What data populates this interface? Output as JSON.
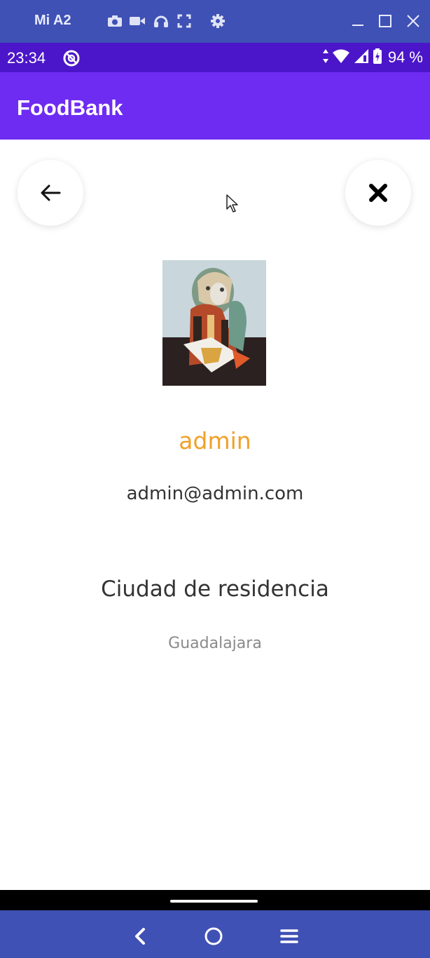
{
  "window": {
    "title": "Mi A2",
    "tools": [
      "camera-icon",
      "video-icon",
      "headset-icon",
      "fullscreen-icon",
      "settings-icon"
    ],
    "controls": [
      "minimize-icon",
      "maximize-icon",
      "close-window-icon"
    ]
  },
  "status_bar": {
    "time": "23:34",
    "battery": "94 %"
  },
  "app_bar": {
    "title": "FoodBank"
  },
  "profile": {
    "name": "admin",
    "email": "admin@admin.com",
    "city_label": "Ciudad de residencia",
    "city": "Guadalajara"
  },
  "colors": {
    "window_bar": "#3f51b5",
    "status_bar": "#4b16c9",
    "app_bar": "#6e2cf2",
    "name_accent": "#f0a12a"
  }
}
